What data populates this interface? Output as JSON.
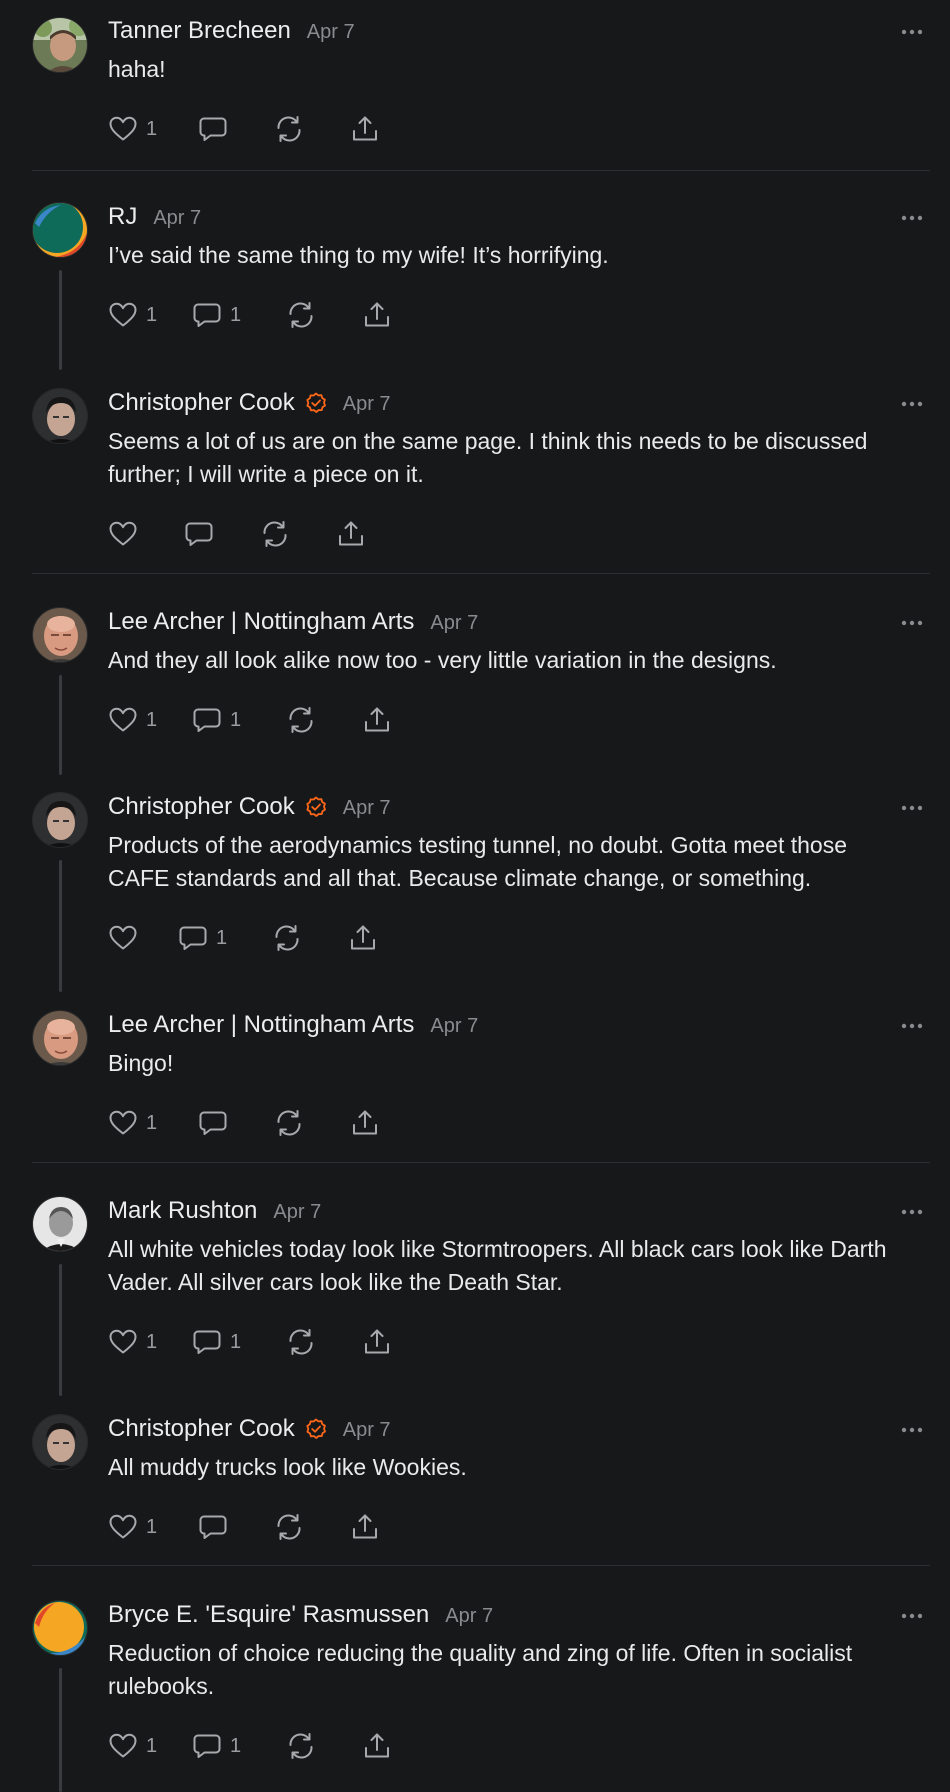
{
  "comments": [
    {
      "author": "Tanner Brecheen",
      "verified": false,
      "date": "Apr 7",
      "text": "haha!",
      "likes": "1",
      "replies": "",
      "avatar": "photo-man-outdoors"
    },
    {
      "author": "RJ",
      "verified": false,
      "date": "Apr 7",
      "text": "I’ve said the same thing to my wife! It’s horrifying.",
      "likes": "1",
      "replies": "1",
      "avatar": "teal-orange-circle"
    },
    {
      "author": "Christopher Cook",
      "verified": true,
      "date": "Apr 7",
      "text": "Seems a lot of us are on the same page. I think this needs to be discussed further; I will write a piece on it.",
      "likes": "",
      "replies": "",
      "avatar": "photo-man-dark-hair"
    },
    {
      "author": "Lee Archer | Nottingham Arts",
      "verified": false,
      "date": "Apr 7",
      "text": "And they all look alike now too - very little variation in the designs.",
      "likes": "1",
      "replies": "1",
      "avatar": "photo-bald-man"
    },
    {
      "author": "Christopher Cook",
      "verified": true,
      "date": "Apr 7",
      "text": "Products of the aerodynamics testing tunnel, no doubt. Gotta meet those CAFE standards and all that. Because climate change, or something.",
      "likes": "",
      "replies": "1",
      "avatar": "photo-man-dark-hair"
    },
    {
      "author": "Lee Archer | Nottingham Arts",
      "verified": false,
      "date": "Apr 7",
      "text": "Bingo!",
      "likes": "1",
      "replies": "",
      "avatar": "photo-bald-man"
    },
    {
      "author": "Mark Rushton",
      "verified": false,
      "date": "Apr 7",
      "text": "All white vehicles today look like Stormtroopers. All black cars look like Darth Vader. All silver cars look like the Death Star.",
      "likes": "1",
      "replies": "1",
      "avatar": "photo-man-black-white"
    },
    {
      "author": "Christopher Cook",
      "verified": true,
      "date": "Apr 7",
      "text": "All muddy trucks look like Wookies.",
      "likes": "1",
      "replies": "",
      "avatar": "photo-man-dark-hair"
    },
    {
      "author": "Bryce E. 'Esquire' Rasmussen",
      "verified": false,
      "date": "Apr 7",
      "text": "Reduction of choice reducing the quality and zing of life. Often in socialist rulebooks.",
      "likes": "1",
      "replies": "1",
      "avatar": "orange-teal-circle"
    }
  ],
  "icons": {
    "like": "heart-icon",
    "reply": "speech-bubble-icon",
    "restack": "refresh-arrows-icon",
    "share": "share-upload-icon",
    "more": "ellipsis-icon",
    "verified": "check-badge-icon"
  },
  "colors": {
    "background": "#17181a",
    "verified": "#ff6719",
    "text": "#eaeaea",
    "muted": "#8a8b8e"
  }
}
